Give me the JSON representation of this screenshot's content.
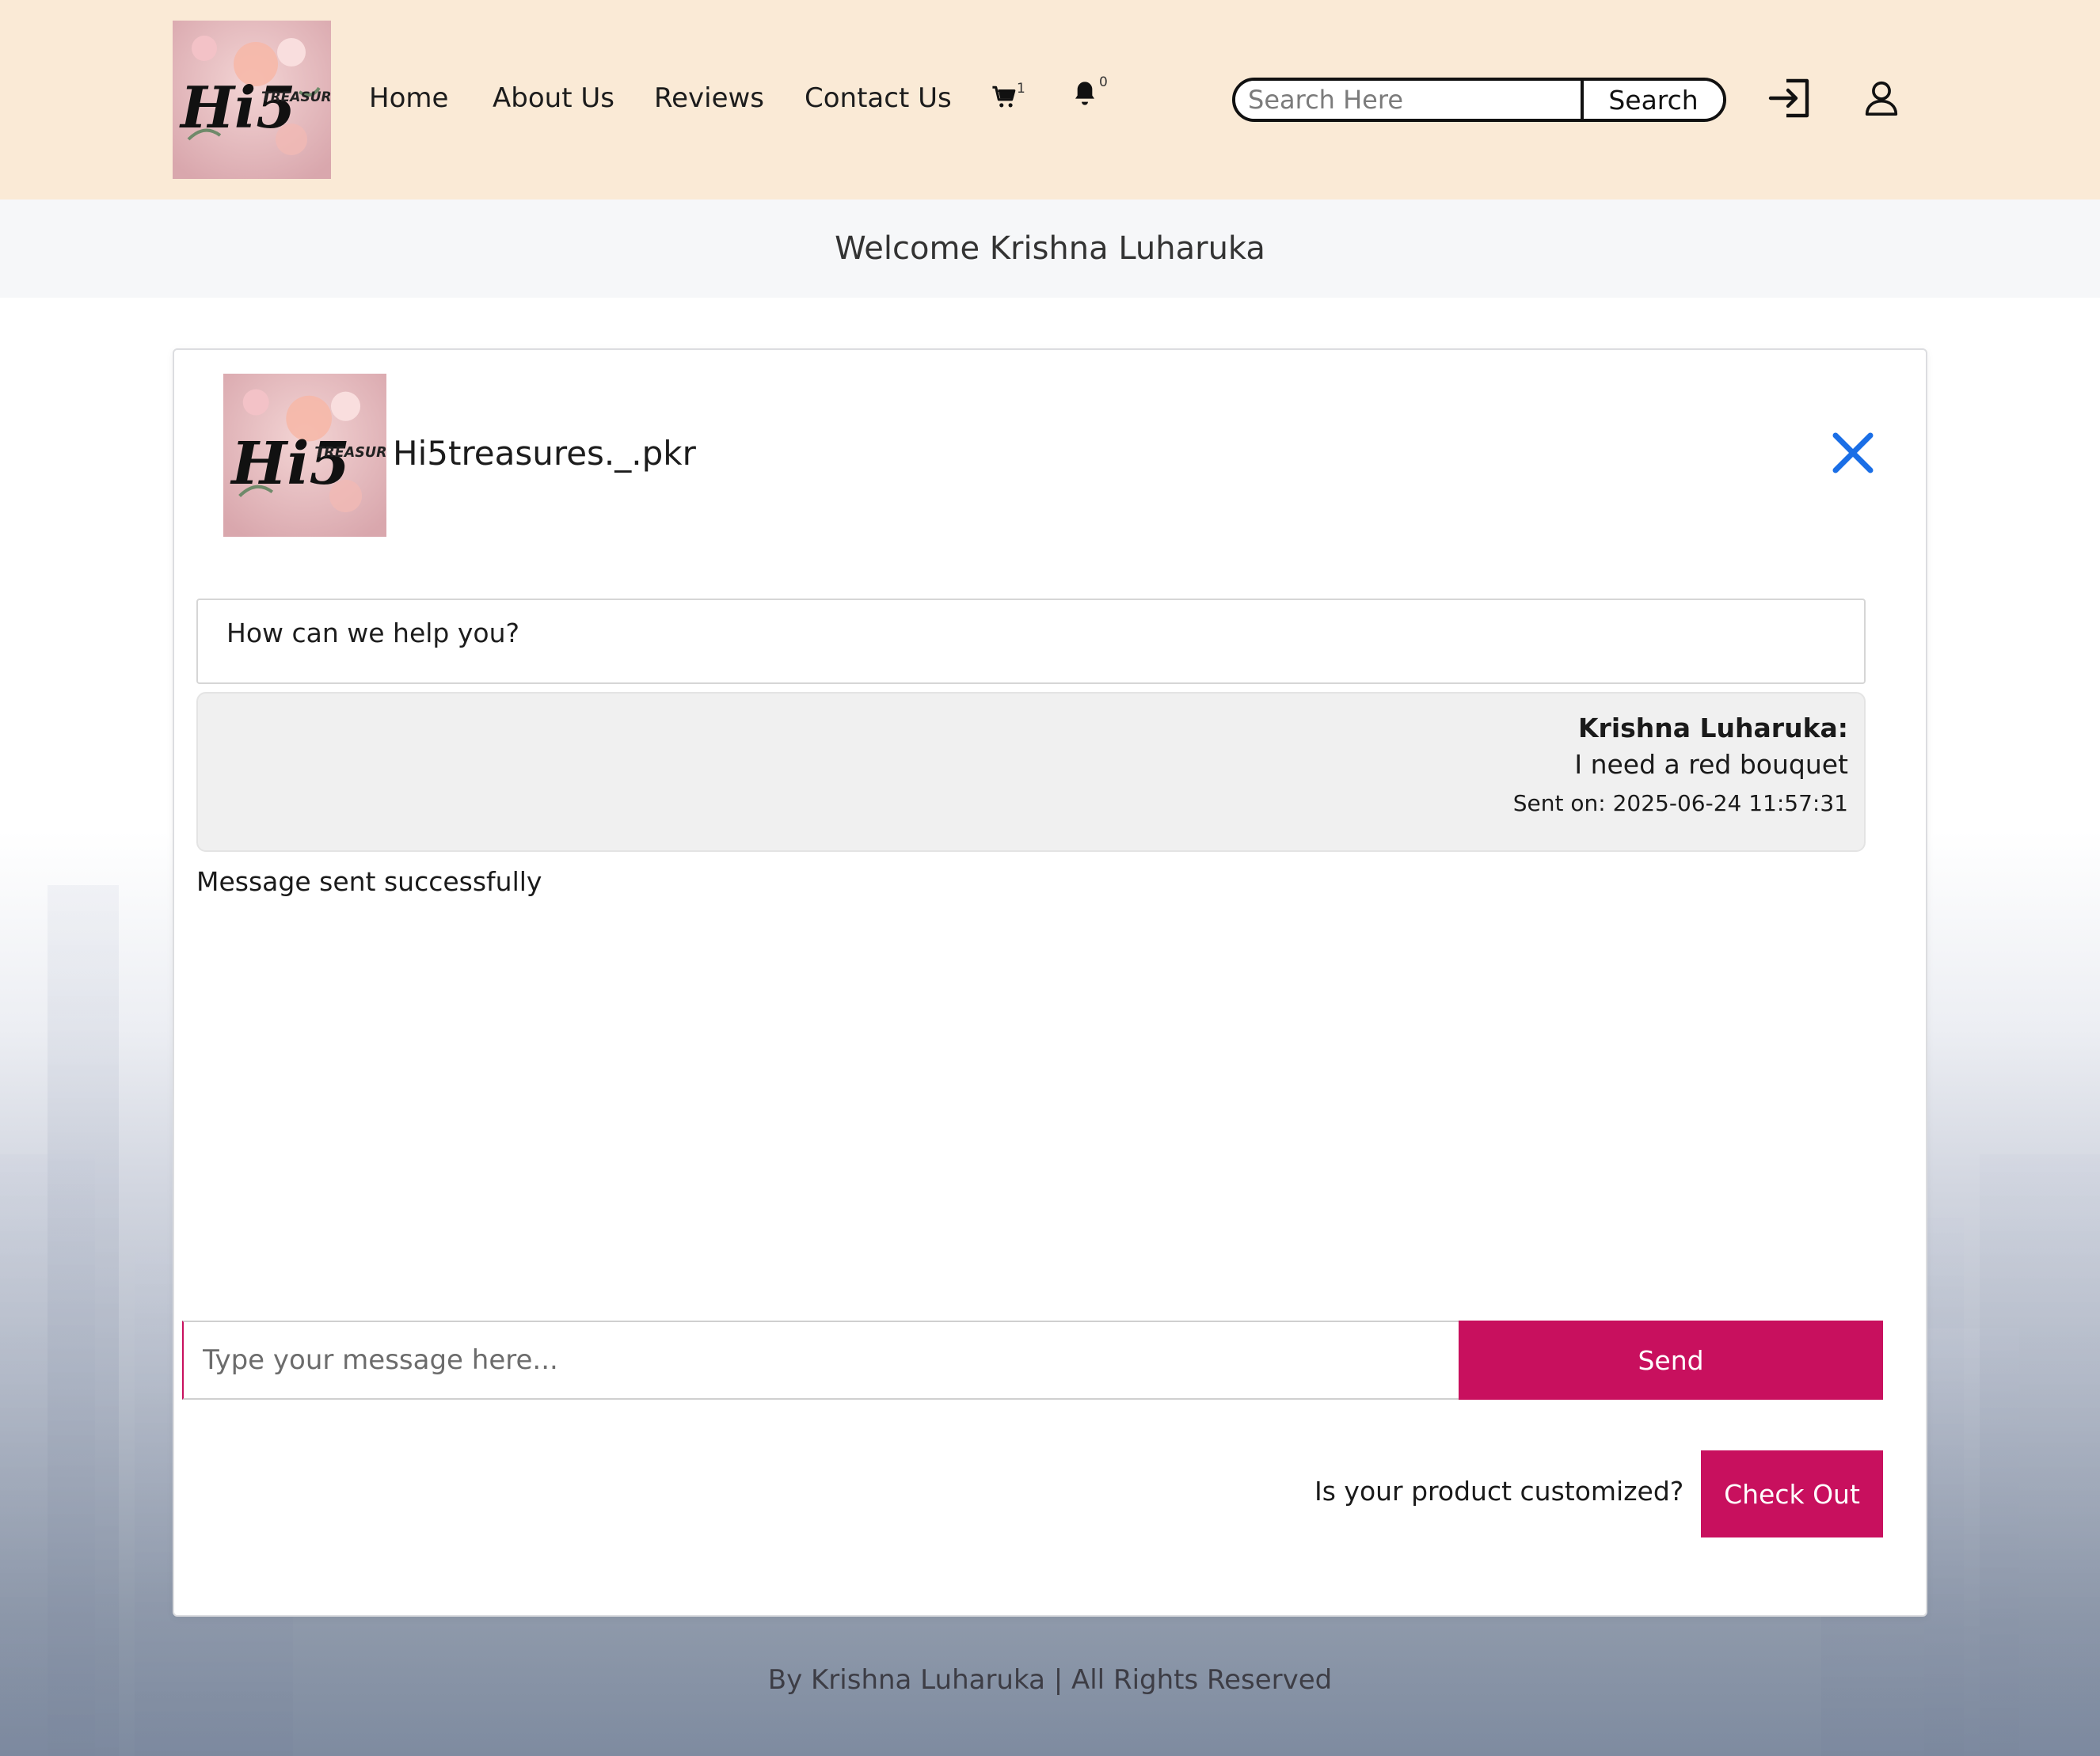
{
  "header": {
    "logo_alt": "Hi5 Treasures logo",
    "logo_text_main": "Hi5",
    "logo_text_side": "TREASURES",
    "nav": [
      {
        "label": "Home"
      },
      {
        "label": "About Us"
      },
      {
        "label": "Reviews"
      },
      {
        "label": "Contact Us"
      }
    ],
    "cart_icon": "cart-icon",
    "cart_count": "1",
    "bell_icon": "bell-icon",
    "notification_count": "0",
    "search": {
      "placeholder": "Search Here",
      "value": "",
      "button_label": "Search"
    },
    "login_icon": "login-icon",
    "profile_icon": "user-icon"
  },
  "welcome": {
    "text": "Welcome Krishna Luharuka"
  },
  "chat": {
    "shop_name": "Hi5treasures._.pkr",
    "close_icon": "close-icon",
    "greeting": "How can we help you?",
    "messages": [
      {
        "sender": "Krishna Luharuka:",
        "text": "I need a red bouquet",
        "sent": "Sent on: 2025-06-24 11:57:31"
      }
    ],
    "status": "Message sent successfully",
    "input": {
      "placeholder": "Type your message here...",
      "value": ""
    },
    "send_label": "Send",
    "custom_question": "Is your product customized?",
    "checkout_label": "Check Out"
  },
  "footer": {
    "text": "By Krishna Luharuka | All Rights Reserved"
  },
  "colors": {
    "header_bg": "#faead6",
    "accent": "#c8105e",
    "close": "#1a6ee6",
    "welcome_bg": "#f6f7f9"
  }
}
